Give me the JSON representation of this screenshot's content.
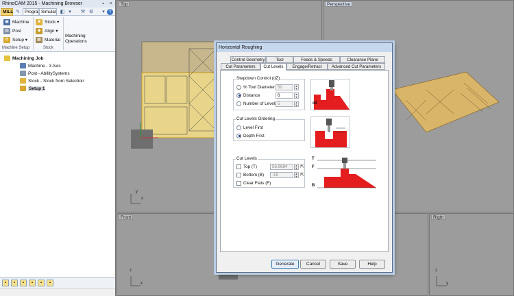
{
  "window": {
    "title": "RhinoCAM 2015 - Machining Browser"
  },
  "tabs": [
    {
      "label": "MILL",
      "active": true
    },
    {
      "label": "Program",
      "active": false
    },
    {
      "label": "Simulate",
      "active": false
    }
  ],
  "ribbon": {
    "machine": "Machine",
    "post": "Post",
    "setup": "Setup",
    "stock": "Stock",
    "align": "Align",
    "material": "Material",
    "machining_ops_line1": "Machining",
    "machining_ops_line2": "Operations",
    "group_machine_setup": "Machine Setup",
    "group_stock": "Stock"
  },
  "tree": {
    "root": "Machining Job",
    "items": [
      "Machine - 3 Axis",
      "Post - AbilitySystems",
      "Stock - Stock from Selection",
      "Setup 1"
    ]
  },
  "viewports": {
    "top": "Top",
    "perspective": "Perspective",
    "front": "Front",
    "right": "Right"
  },
  "axes": {
    "x": "x",
    "y": "y",
    "z": "z"
  },
  "dialog": {
    "title": "Horizontal Roughing",
    "tabs_row1": [
      "Control Geometry",
      "Tool",
      "Feeds & Speeds",
      "Clearance Plane"
    ],
    "tabs_row2": [
      "Cut Parameters",
      "Cut Levels",
      "Engage/Retract",
      "Advanced Cut Parameters"
    ],
    "active_tab": "Cut Levels",
    "stepdown": {
      "group": "Stepdown Control (dZ)",
      "opt1": "% Tool Diameter",
      "val1": "50",
      "opt2": "Distance",
      "val2": "6",
      "opt3": "Number of Levels",
      "val3": "5",
      "selected": "Distance",
      "illus_label": "dZ"
    },
    "ordering": {
      "group": "Cut Levels Ordering",
      "opt1": "Level First",
      "opt2": "Depth First",
      "selected": "Depth First"
    },
    "cutlevels": {
      "group": "Cut Levels",
      "top_label": "Top (T)",
      "top_val": "56.9684",
      "bottom_label": "Bottom (B)",
      "bottom_val": "-15",
      "clear_flats": "Clear Flats (F)",
      "illus_t": "T",
      "illus_f": "F",
      "illus_b": "B"
    },
    "buttons": {
      "generate": "Generate",
      "cancel": "Cancel",
      "save": "Save",
      "help": "Help"
    }
  }
}
